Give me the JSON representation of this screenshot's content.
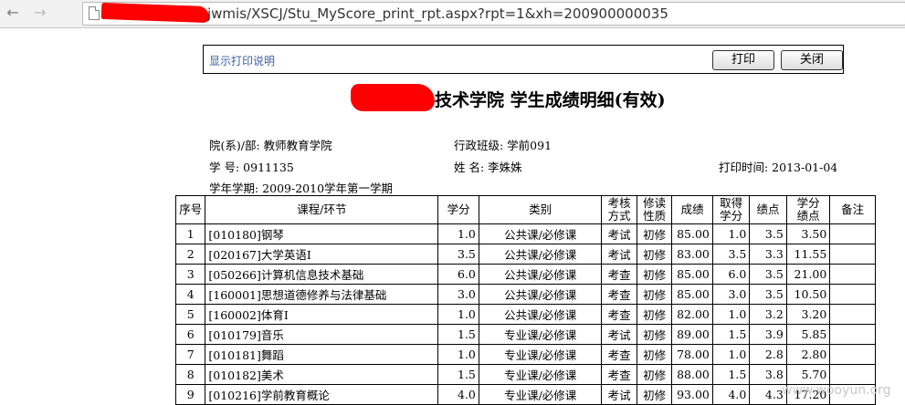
{
  "browser": {
    "back_icon": "←",
    "forward_icon": "→",
    "reload_icon": "C",
    "url": "jwmis/XSCJ/Stu_MyScore_print_rpt.aspx?rpt=1&xh=200900000035"
  },
  "toolbar": {
    "help_link": "显示打印说明",
    "print_button": "打印",
    "close_button": "关闭"
  },
  "report": {
    "title": "技术学院  学生成绩明细(有效)",
    "department": "院(系)/部: 教师教育学院",
    "class": "行政班级: 学前091",
    "student_id": "学      号: 0911135",
    "name": "姓      名: 李姝姝",
    "print_time": "打印时间: 2013-01-04",
    "term": "学年学期: 2009-2010学年第一学期"
  },
  "table": {
    "headers": {
      "no": "序号",
      "course": "课程/环节",
      "credit": "学分",
      "category": "类别",
      "exam_a": "考核",
      "exam_b": "方式",
      "study_a": "修读",
      "study_b": "性质",
      "score": "成绩",
      "earned_a": "取得",
      "earned_b": "学分",
      "gpa": "绩点",
      "cgpa_a": "学分",
      "cgpa_b": "绩点",
      "note": "备注"
    },
    "rows": [
      {
        "no": "1",
        "course": "[010180]钢琴",
        "credit": "1.0",
        "category": "公共课/必修课",
        "exam": "考试",
        "study": "初修",
        "score": "85.00",
        "earned": "1.0",
        "gpa": "3.5",
        "cgpa": "3.50",
        "note": ""
      },
      {
        "no": "2",
        "course": "[020167]大学英语Ⅰ",
        "credit": "3.5",
        "category": "公共课/必修课",
        "exam": "考试",
        "study": "初修",
        "score": "83.00",
        "earned": "3.5",
        "gpa": "3.3",
        "cgpa": "11.55",
        "note": ""
      },
      {
        "no": "3",
        "course": "[050266]计算机信息技术基础",
        "credit": "6.0",
        "category": "公共课/必修课",
        "exam": "考查",
        "study": "初修",
        "score": "85.00",
        "earned": "6.0",
        "gpa": "3.5",
        "cgpa": "21.00",
        "note": ""
      },
      {
        "no": "4",
        "course": "[160001]思想道德修养与法律基础",
        "credit": "3.0",
        "category": "公共课/必修课",
        "exam": "考查",
        "study": "初修",
        "score": "85.00",
        "earned": "3.0",
        "gpa": "3.5",
        "cgpa": "10.50",
        "note": ""
      },
      {
        "no": "5",
        "course": "[160002]体育Ⅰ",
        "credit": "1.0",
        "category": "公共课/必修课",
        "exam": "考查",
        "study": "初修",
        "score": "82.00",
        "earned": "1.0",
        "gpa": "3.2",
        "cgpa": "3.20",
        "note": ""
      },
      {
        "no": "6",
        "course": "[010179]音乐",
        "credit": "1.5",
        "category": "专业课/必修课",
        "exam": "考试",
        "study": "初修",
        "score": "89.00",
        "earned": "1.5",
        "gpa": "3.9",
        "cgpa": "5.85",
        "note": ""
      },
      {
        "no": "7",
        "course": "[010181]舞蹈",
        "credit": "1.0",
        "category": "专业课/必修课",
        "exam": "考查",
        "study": "初修",
        "score": "78.00",
        "earned": "1.0",
        "gpa": "2.8",
        "cgpa": "2.80",
        "note": ""
      },
      {
        "no": "8",
        "course": "[010182]美术",
        "credit": "1.5",
        "category": "专业课/必修课",
        "exam": "考查",
        "study": "初修",
        "score": "88.00",
        "earned": "1.5",
        "gpa": "3.8",
        "cgpa": "5.70",
        "note": ""
      },
      {
        "no": "9",
        "course": "[010216]学前教育概论",
        "credit": "4.0",
        "category": "专业课/必修课",
        "exam": "考试",
        "study": "初修",
        "score": "93.00",
        "earned": "4.0",
        "gpa": "4.3",
        "cgpa": "17.20",
        "note": ""
      }
    ]
  },
  "watermark": "www.wooyun.org"
}
